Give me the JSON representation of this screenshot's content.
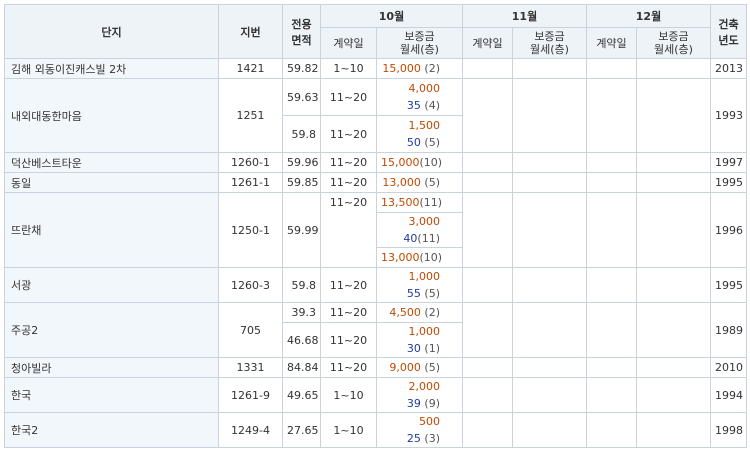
{
  "header": {
    "complex": "단지",
    "lot": "지번",
    "area": "전용\n면적",
    "months": [
      "10월",
      "11월",
      "12월"
    ],
    "contract_day": "계약일",
    "price": "보증금\n월세(층)",
    "built_year": "건축\n년도"
  },
  "rows": [
    {
      "name": "김해 외동이진캐스빌 2차",
      "lot": "1421",
      "area": "59.82",
      "day": "1~10",
      "deposit": "15,000",
      "monthly": "",
      "floor": "(2)",
      "year": "2013"
    },
    {
      "name": "내외대동한마음",
      "lot": "1251",
      "area": "59.63",
      "day": "11~20",
      "deposit": "4,000",
      "monthly": "35",
      "floor": "(4)",
      "year": "1993"
    },
    {
      "area": "59.8",
      "day": "11~20",
      "deposit": "1,500",
      "monthly": "50",
      "floor": "(5)"
    },
    {
      "name": "덕산베스트타운",
      "lot": "1260-1",
      "area": "59.96",
      "day": "11~20",
      "deposit": "15,000",
      "monthly": "",
      "floor": "(10)",
      "year": "1997"
    },
    {
      "name": "동일",
      "lot": "1261-1",
      "area": "59.85",
      "day": "11~20",
      "deposit": "13,000",
      "monthly": "",
      "floor": "(5)",
      "year": "1995"
    },
    {
      "name": "뜨란채",
      "lot": "1250-1",
      "area": "59.99",
      "day": "11~20",
      "deposit": "13,500",
      "monthly": "",
      "floor": "(11)",
      "year": "1996"
    },
    {
      "deposit": "3,000",
      "monthly": "40",
      "floor": "(11)"
    },
    {
      "deposit": "13,000",
      "monthly": "",
      "floor": "(10)"
    },
    {
      "name": "서광",
      "lot": "1260-3",
      "area": "59.8",
      "day": "11~20",
      "deposit": "1,000",
      "monthly": "55",
      "floor": "(5)",
      "year": "1995"
    },
    {
      "name": "주공2",
      "lot": "705",
      "area": "39.3",
      "day": "11~20",
      "deposit": "4,500",
      "monthly": "",
      "floor": "(2)",
      "year": "1989"
    },
    {
      "area": "46.68",
      "day": "11~20",
      "deposit": "1,000",
      "monthly": "30",
      "floor": "(1)"
    },
    {
      "name": "청아빌라",
      "lot": "1331",
      "area": "84.84",
      "day": "11~20",
      "deposit": "9,000",
      "monthly": "",
      "floor": "(5)",
      "year": "2010"
    },
    {
      "name": "한국",
      "lot": "1261-9",
      "area": "49.65",
      "day": "1~10",
      "deposit": "2,000",
      "monthly": "39",
      "floor": "(9)",
      "year": "1994"
    },
    {
      "name": "한국2",
      "lot": "1249-4",
      "area": "27.65",
      "day": "1~10",
      "deposit": "500",
      "monthly": "25",
      "floor": "(3)",
      "year": "1998"
    }
  ]
}
